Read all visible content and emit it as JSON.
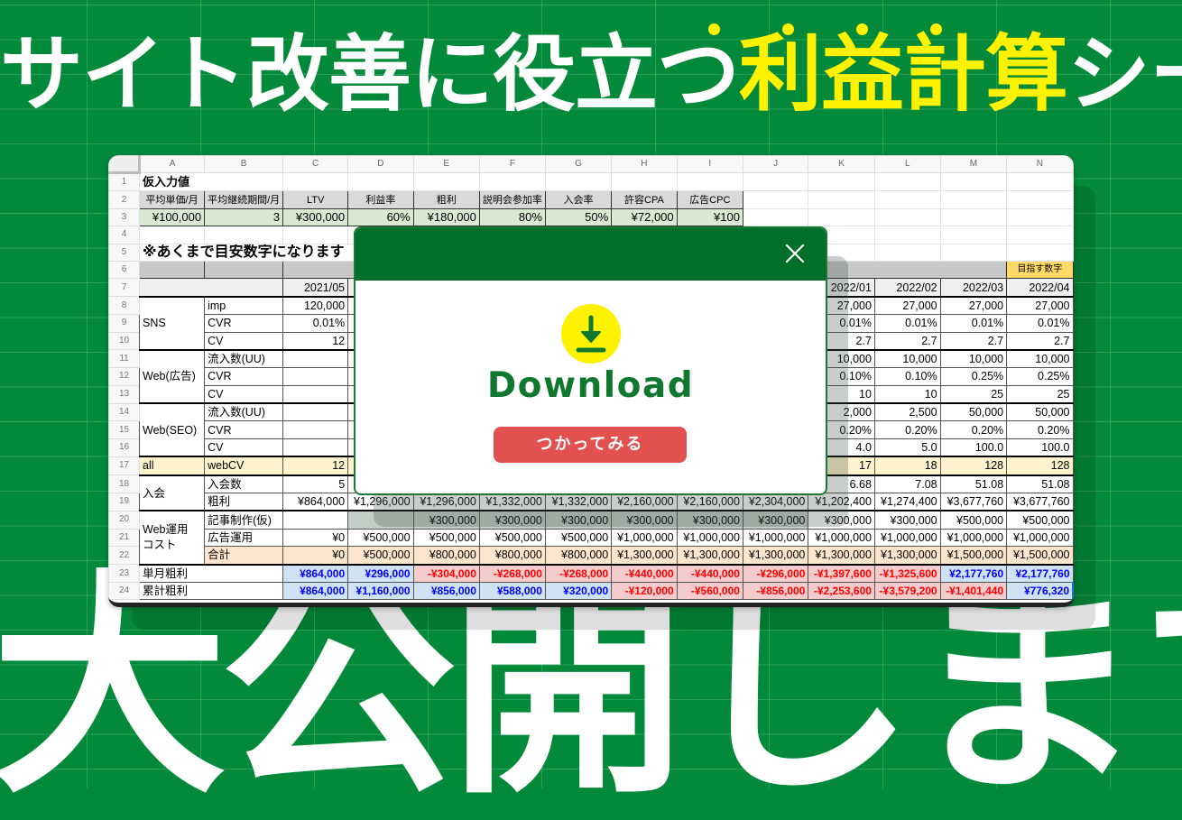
{
  "headline": {
    "prefix": "サイト改善に役立つ",
    "highlight": "利益計算",
    "suffix": "シート",
    "emphasis_dots": 4,
    "highlight_color": "#fff200"
  },
  "bottom_text": "大公開します",
  "colors": {
    "background": "#028a3a",
    "modal_header": "#006f2c",
    "download_green": "#10782e",
    "download_circle": "#fff200",
    "try_button": "#e35050",
    "positive_value": "#0000ff",
    "negative_value": "#ff0000"
  },
  "spreadsheet": {
    "columns": [
      "A",
      "B",
      "C",
      "D",
      "E",
      "F",
      "G",
      "H",
      "I",
      "J",
      "K",
      "L",
      "M",
      "N"
    ],
    "row_numbers": [
      "1",
      "2",
      "3",
      "4",
      "5",
      "6",
      "7",
      "8",
      "9",
      "10",
      "11",
      "12",
      "13",
      "14",
      "15",
      "16",
      "17",
      "18",
      "19",
      "20",
      "21",
      "22",
      "23",
      "24"
    ],
    "input_title": "仮入力値",
    "input_headers": [
      "平均単価/月",
      "平均継続期間/月",
      "LTV",
      "利益率",
      "粗利",
      "説明会参加率",
      "入会率",
      "許容CPA",
      "広告CPC"
    ],
    "input_values": [
      "¥100,000",
      "3",
      "¥300,000",
      "60%",
      "¥180,000",
      "80%",
      "50%",
      "¥72,000",
      "¥100"
    ],
    "note": "※あくまで目安数字になります",
    "goal_label": "目指す数字",
    "months": [
      "2021/05",
      "",
      "",
      "",
      "",
      "",
      "",
      "",
      "2022/01",
      "2022/02",
      "2022/03",
      "2022/04"
    ],
    "rows": [
      {
        "group": "SNS",
        "label": "imp",
        "values": [
          "120,000",
          "",
          "",
          "",
          "",
          "",
          "",
          "",
          "27,000",
          "27,000",
          "27,000",
          "27,000"
        ]
      },
      {
        "group": "",
        "label": "CVR",
        "values": [
          "0.01%",
          "",
          "",
          "",
          "",
          "",
          "",
          "",
          "0.01%",
          "0.01%",
          "0.01%",
          "0.01%"
        ]
      },
      {
        "group": "",
        "label": "CV",
        "values": [
          "12",
          "",
          "",
          "",
          "",
          "",
          "",
          "",
          "2.7",
          "2.7",
          "2.7",
          "2.7"
        ]
      },
      {
        "group": "Web(広告)",
        "label": "流入数(UU)",
        "values": [
          "",
          "",
          "",
          "",
          "",
          "",
          "",
          "",
          "10,000",
          "10,000",
          "10,000",
          "10,000"
        ]
      },
      {
        "group": "",
        "label": "CVR",
        "values": [
          "",
          "",
          "",
          "",
          "",
          "",
          "",
          "",
          "0.10%",
          "0.10%",
          "0.25%",
          "0.25%"
        ]
      },
      {
        "group": "",
        "label": "CV",
        "values": [
          "",
          "",
          "",
          "",
          "",
          "",
          "",
          "",
          "10",
          "10",
          "25",
          "25"
        ]
      },
      {
        "group": "Web(SEO)",
        "label": "流入数(UU)",
        "values": [
          "",
          "",
          "",
          "",
          "",
          "",
          "",
          "",
          "2,000",
          "2,500",
          "50,000",
          "50,000"
        ]
      },
      {
        "group": "",
        "label": "CVR",
        "values": [
          "",
          "",
          "",
          "",
          "",
          "",
          "",
          "",
          "0.20%",
          "0.20%",
          "0.20%",
          "0.20%"
        ]
      },
      {
        "group": "",
        "label": "CV",
        "values": [
          "",
          "",
          "",
          "",
          "",
          "",
          "",
          "",
          "4.0",
          "5.0",
          "100.0",
          "100.0"
        ]
      },
      {
        "group": "all",
        "label": "webCV",
        "values": [
          "12",
          "",
          "",
          "",
          "",
          "",
          "",
          "",
          "17",
          "18",
          "128",
          "128"
        ]
      },
      {
        "group": "入会",
        "label": "入会数",
        "values": [
          "5",
          "",
          "",
          "",
          "",
          "",
          "",
          "",
          "6.68",
          "7.08",
          "51.08",
          "51.08"
        ]
      },
      {
        "group": "",
        "label": "粗利",
        "values": [
          "¥864,000",
          "¥1,296,000",
          "¥1,296,000",
          "¥1,332,000",
          "¥1,332,000",
          "¥2,160,000",
          "¥2,160,000",
          "¥2,304,000",
          "¥1,202,400",
          "¥1,274,400",
          "¥3,677,760",
          "¥3,677,760"
        ]
      },
      {
        "group": "Web運用\nコスト",
        "label": "記事制作(仮)",
        "values": [
          "",
          "",
          "¥300,000",
          "¥300,000",
          "¥300,000",
          "¥300,000",
          "¥300,000",
          "¥300,000",
          "¥300,000",
          "¥300,000",
          "¥500,000",
          "¥500,000"
        ]
      },
      {
        "group": "",
        "label": "広告運用",
        "values": [
          "¥0",
          "¥500,000",
          "¥500,000",
          "¥500,000",
          "¥500,000",
          "¥1,000,000",
          "¥1,000,000",
          "¥1,000,000",
          "¥1,000,000",
          "¥1,000,000",
          "¥1,000,000",
          "¥1,000,000"
        ]
      },
      {
        "group": "",
        "label": "合計",
        "values": [
          "¥0",
          "¥500,000",
          "¥800,000",
          "¥800,000",
          "¥800,000",
          "¥1,300,000",
          "¥1,300,000",
          "¥1,300,000",
          "¥1,300,000",
          "¥1,300,000",
          "¥1,500,000",
          "¥1,500,000"
        ]
      }
    ],
    "monthly_profit": {
      "label": "単月粗利",
      "values": [
        "¥864,000",
        "¥296,000",
        "-¥304,000",
        "-¥268,000",
        "-¥268,000",
        "-¥440,000",
        "-¥440,000",
        "-¥296,000",
        "-¥1,397,600",
        "-¥1,325,600",
        "¥2,177,760",
        "¥2,177,760"
      ]
    },
    "cumulative_profit": {
      "label": "累計粗利",
      "values": [
        "¥864,000",
        "¥1,160,000",
        "¥856,000",
        "¥588,000",
        "¥320,000",
        "-¥120,000",
        "-¥560,000",
        "-¥856,000",
        "-¥2,253,600",
        "-¥3,579,200",
        "-¥1,401,440",
        "¥776,320"
      ]
    }
  },
  "modal": {
    "close_icon": "close-icon",
    "download_icon": "download-icon",
    "title": "Download",
    "button_label": "つかってみる"
  }
}
